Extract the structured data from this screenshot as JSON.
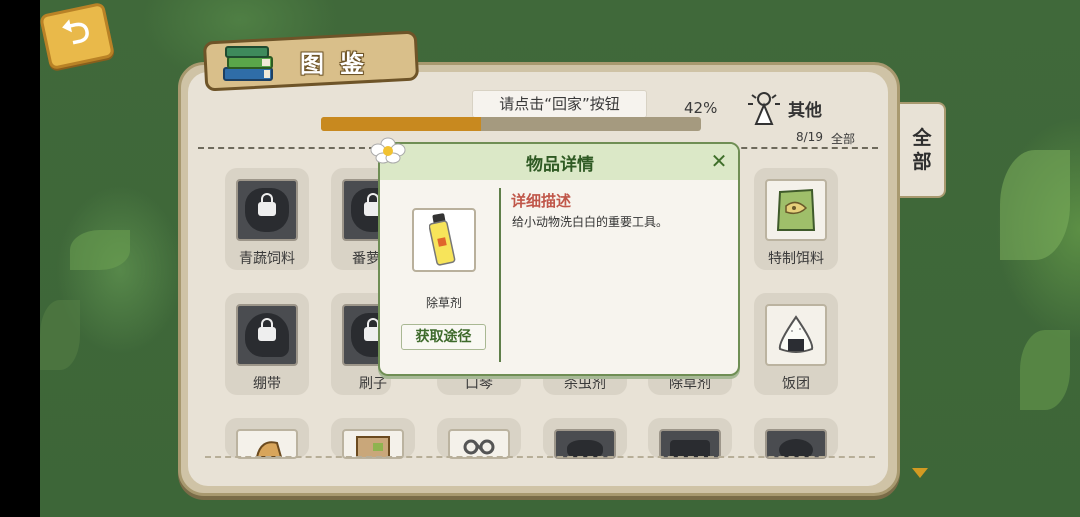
{
  "header": {
    "title": "图鉴",
    "hint": "请点击“回家”按钮",
    "progress_percent": "42%",
    "progress_fraction": 0.42,
    "category_label": "其他",
    "collected_count": "8/19",
    "collected_scope": "全部"
  },
  "side_tab": {
    "line1": "全",
    "line2": "部"
  },
  "grid": {
    "row1": [
      {
        "label": "青蔬饲料",
        "locked": true
      },
      {
        "label": "番萝",
        "locked": true
      },
      {
        "label": "特制饵料",
        "locked": false
      }
    ],
    "row2": [
      {
        "label": "绷带",
        "locked": true
      },
      {
        "label": "刷子",
        "locked": true
      },
      {
        "label": "口琴"
      },
      {
        "label": "杀虫剂"
      },
      {
        "label": "除草剂"
      },
      {
        "label": "饭团",
        "locked": false
      }
    ]
  },
  "modal": {
    "title": "物品详情",
    "item_name": "除草剂",
    "acquire_label": "获取途径",
    "desc_title": "详细描述",
    "desc_text": "给小动物洗白白的重要工具。"
  },
  "colors": {
    "accent": "#c8891f",
    "modal_header": "#dbe8c7",
    "desc_title": "#c0574a"
  }
}
